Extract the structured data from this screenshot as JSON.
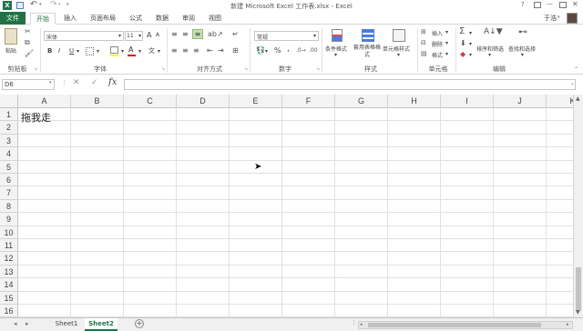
{
  "window": {
    "title": "新建 Microsoft Excel 工作表.xlsx - Excel",
    "user": "于浩",
    "controls": [
      "?",
      "▢",
      "—",
      "▢",
      "✕"
    ]
  },
  "quick_access": {
    "icons": [
      "excel-icon",
      "save-icon",
      "undo-icon",
      "redo-icon",
      "customize-icon"
    ]
  },
  "tabs": [
    "文件",
    "开始",
    "插入",
    "页面布局",
    "公式",
    "数据",
    "审阅",
    "视图"
  ],
  "active_tab": "开始",
  "ribbon": {
    "clipboard": {
      "label": "剪贴板",
      "paste": "粘贴"
    },
    "font": {
      "label": "字体",
      "name": "宋体",
      "size": "11",
      "bold": "B",
      "italic": "I",
      "underline": "U",
      "grow": "A",
      "shrink": "A"
    },
    "alignment": {
      "label": "对齐方式"
    },
    "number": {
      "label": "数字",
      "format": "常规",
      "percent": "%",
      "comma": ","
    },
    "styles": {
      "label": "样式",
      "conditional": "条件格式",
      "table": "套用表格格式",
      "cell": "单元格样式"
    },
    "cells": {
      "label": "单元格",
      "insert": "插入",
      "delete": "删除",
      "format": "格式"
    },
    "editing": {
      "label": "编辑",
      "sort": "排序和筛选",
      "find": "查找和选择"
    }
  },
  "formula_bar": {
    "name_box": "D6",
    "cancel": "✕",
    "enter": "✓",
    "fx": "fx",
    "value": ""
  },
  "columns": [
    "A",
    "B",
    "C",
    "D",
    "E",
    "F",
    "G",
    "H",
    "I",
    "J",
    "K"
  ],
  "rows": [
    "1",
    "2",
    "3",
    "4",
    "5",
    "6",
    "7",
    "8",
    "9",
    "10",
    "11",
    "12",
    "13",
    "14",
    "15",
    "16"
  ],
  "cells": {
    "A1": "拖我走"
  },
  "sheets": [
    "Sheet1",
    "Sheet2"
  ],
  "active_sheet": "Sheet2",
  "add_sheet": "+",
  "colors": {
    "brand": "#217346",
    "header_bg": "#f3f3f3",
    "grid": "#e1e1e1"
  }
}
